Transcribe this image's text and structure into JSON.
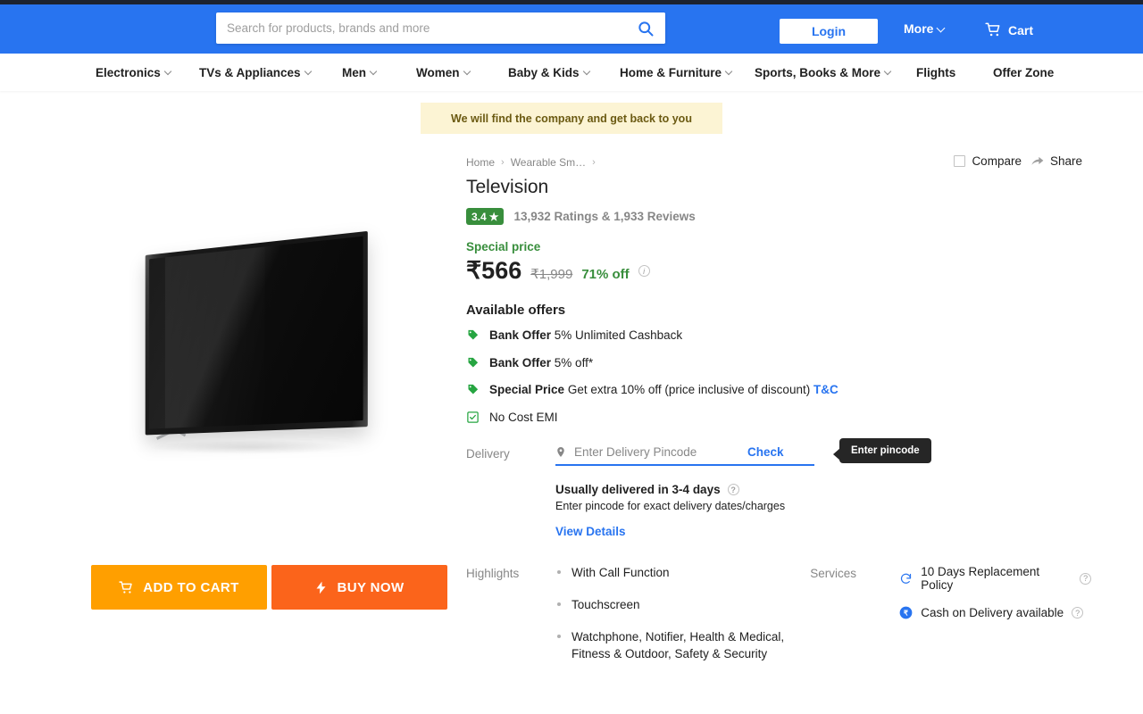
{
  "header": {
    "search": {
      "placeholder": "Search for products, brands and more",
      "value": "",
      "icon": "search-icon"
    },
    "login_label": "Login",
    "more_label": "More",
    "cart_label": "Cart"
  },
  "nav": {
    "items": [
      {
        "label": "Electronics",
        "caret": true
      },
      {
        "label": "TVs & Appliances",
        "caret": true
      },
      {
        "label": "Men",
        "caret": true
      },
      {
        "label": "Women",
        "caret": true
      },
      {
        "label": "Baby & Kids",
        "caret": true
      },
      {
        "label": "Home & Furniture",
        "caret": true
      },
      {
        "label": "Sports, Books & More",
        "caret": true
      },
      {
        "label": "Flights",
        "caret": false
      },
      {
        "label": "Offer Zone",
        "caret": false
      }
    ]
  },
  "banner": {
    "text": "We will find the company and get back to you"
  },
  "actions": {
    "compare_label": "Compare",
    "share_label": "Share"
  },
  "product": {
    "breadcrumb": [
      "Home",
      "Wearable Sm…"
    ],
    "title": "Television",
    "rating_value": "3.4",
    "rating_star": "★",
    "rating_count": "13,932 Ratings & 1,933 Reviews",
    "special_price_label": "Special price",
    "price": "₹566",
    "price_original": "₹1,999",
    "discount": "71% off"
  },
  "offers": {
    "title": "Available offers",
    "items": [
      {
        "icon": "offer-tag-icon",
        "bold": "Bank Offer",
        "text": "5% Unlimited Cashback",
        "link": ""
      },
      {
        "icon": "offer-tag-icon",
        "bold": "Bank Offer",
        "text": "5% off*",
        "link": ""
      },
      {
        "icon": "offer-tag-icon",
        "bold": "Special Price",
        "text": "Get extra 10% off (price inclusive of discount)",
        "link": "T&C"
      },
      {
        "icon": "emi-check-icon",
        "bold": "",
        "text": "No Cost EMI",
        "link": ""
      }
    ]
  },
  "delivery": {
    "label": "Delivery",
    "pincode_placeholder": "Enter Delivery Pincode",
    "pincode_value": "",
    "check_label": "Check",
    "tooltip": "Enter pincode",
    "eta": "Usually delivered in 3-4 days",
    "note": "Enter pincode for exact delivery dates/charges",
    "view_details": "View Details"
  },
  "highlights": {
    "label": "Highlights",
    "items": [
      "With Call Function",
      "Touchscreen",
      "Watchphone, Notifier, Health & Medical, Fitness & Outdoor, Safety & Security"
    ]
  },
  "services": {
    "label": "Services",
    "items": [
      {
        "icon": "replacement-icon",
        "text": "10 Days Replacement Policy"
      },
      {
        "icon": "cod-rupee-icon",
        "text": "Cash on Delivery available"
      }
    ]
  },
  "buttons": {
    "add_to_cart": "ADD TO CART",
    "buy_now": "BUY NOW"
  },
  "colors": {
    "brand_blue": "#2874f0",
    "top_strip": "#1c2331",
    "banner_bg": "#fcf4d4",
    "rating_green": "#388e3c",
    "cart_orange": "#ff9f00",
    "buy_orange": "#fb641b",
    "tooltip_bg": "#262626"
  }
}
